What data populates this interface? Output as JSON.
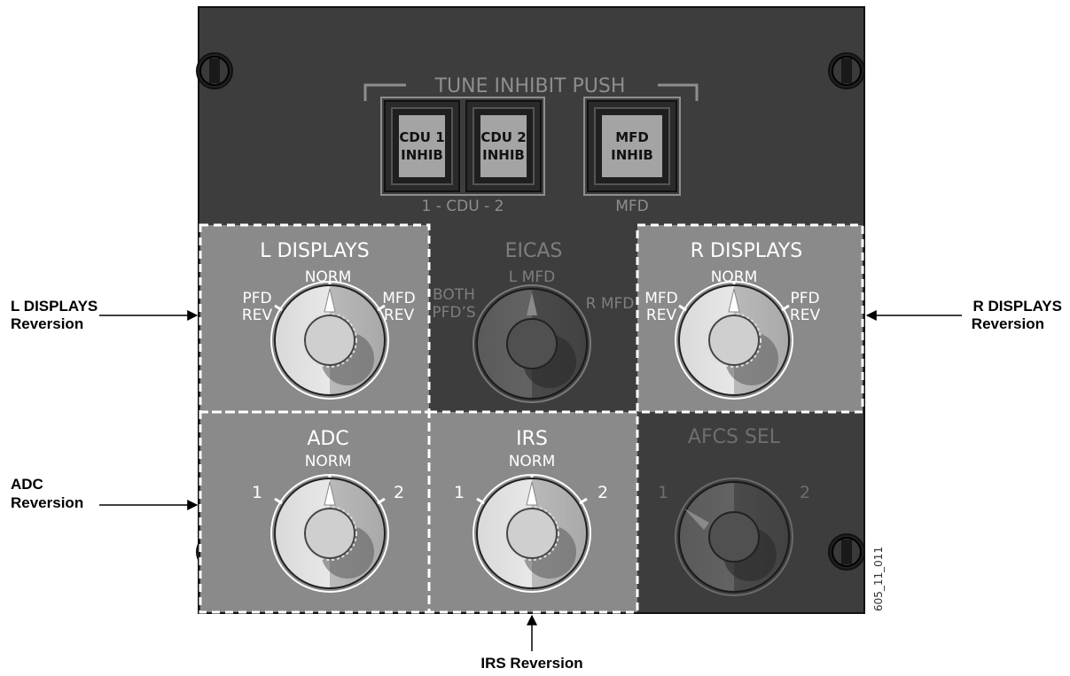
{
  "panel": {
    "tune_inhibit_label": "TUNE INHIBIT PUSH",
    "cdu_group_label": "1 - CDU - 2",
    "mfd_group_label": "MFD",
    "figure_id": "605_11_011"
  },
  "buttons": [
    {
      "line1": "CDU 1",
      "line2": "INHIB"
    },
    {
      "line1": "CDU 2",
      "line2": "INHIB"
    },
    {
      "line1": "MFD",
      "line2": "INHIB"
    }
  ],
  "knobs": {
    "l_displays": {
      "title": "L DISPLAYS",
      "top": "NORM",
      "left1": "PFD",
      "left2": "REV",
      "right1": "MFD",
      "right2": "REV"
    },
    "eicas": {
      "title": "EICAS",
      "top": "L MFD",
      "left1": "BOTH",
      "left2": "PFD’S",
      "right1": "R MFD"
    },
    "r_displays": {
      "title": "R DISPLAYS",
      "top": "NORM",
      "left1": "MFD",
      "left2": "REV",
      "right1": "PFD",
      "right2": "REV"
    },
    "adc": {
      "title": "ADC",
      "top": "NORM",
      "left1": "1",
      "right1": "2"
    },
    "irs": {
      "title": "IRS",
      "top": "NORM",
      "left1": "1",
      "right1": "2"
    },
    "afcs_sel": {
      "title": "AFCS SEL",
      "left1": "1",
      "right1": "2"
    }
  },
  "callouts": {
    "l_displays": {
      "line1": "L DISPLAYS",
      "line2": "Reversion"
    },
    "adc": {
      "line1": "ADC",
      "line2": "Reversion"
    },
    "r_displays": {
      "line1": "R DISPLAYS",
      "line2": "Reversion"
    },
    "irs": {
      "line1": "IRS Reversion"
    }
  }
}
